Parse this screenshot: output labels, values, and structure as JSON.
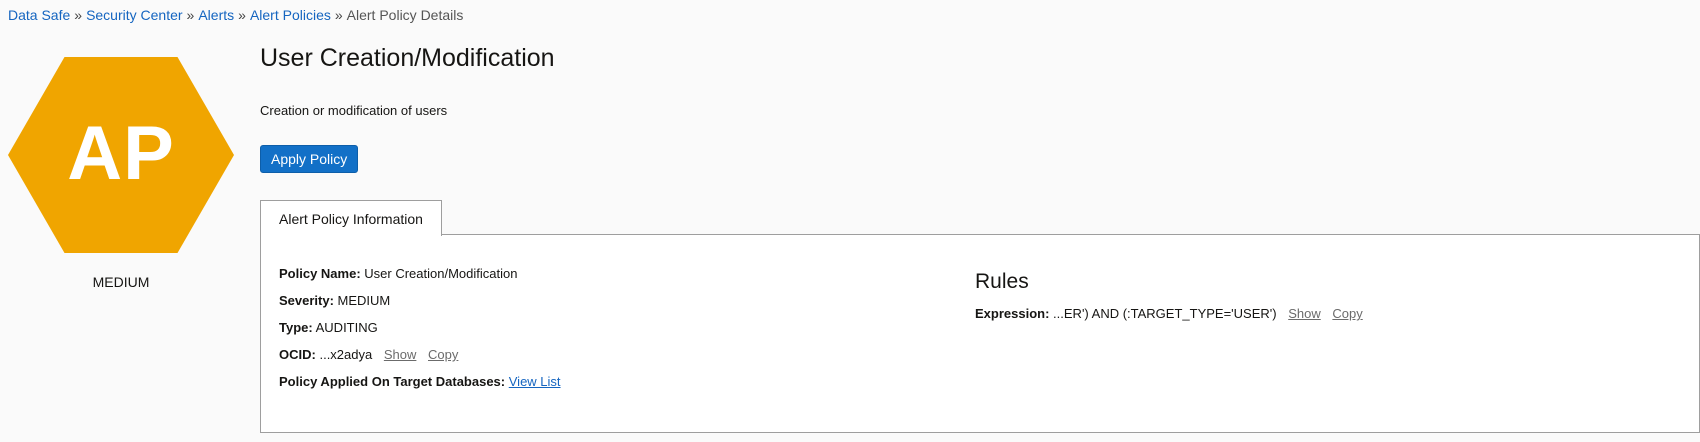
{
  "breadcrumb": {
    "items": [
      "Data Safe",
      "Security Center",
      "Alerts",
      "Alert Policies"
    ],
    "separator": "»",
    "current": "Alert Policy Details"
  },
  "badge": {
    "initials": "AP",
    "color": "#f0a500",
    "severity": "MEDIUM"
  },
  "header": {
    "title": "User Creation/Modification",
    "description": "Creation or modification of users",
    "apply_button": "Apply Policy"
  },
  "tabs": [
    {
      "label": "Alert Policy Information",
      "active": true
    }
  ],
  "info": {
    "policy_name_label": "Policy Name:",
    "policy_name": "User Creation/Modification",
    "severity_label": "Severity:",
    "severity": "MEDIUM",
    "type_label": "Type:",
    "type": "AUDITING",
    "ocid_label": "OCID:",
    "ocid": "...x2adya",
    "show_label": "Show",
    "copy_label": "Copy",
    "applied_label": "Policy Applied On Target Databases:",
    "view_list_label": "View List"
  },
  "rules": {
    "title": "Rules",
    "expression_label": "Expression:",
    "expression": "...ER') AND (:TARGET_TYPE='USER')",
    "show_label": "Show",
    "copy_label": "Copy"
  },
  "colors": {
    "link": "#1565c0",
    "button": "#1270c7",
    "badge": "#f0a500"
  }
}
